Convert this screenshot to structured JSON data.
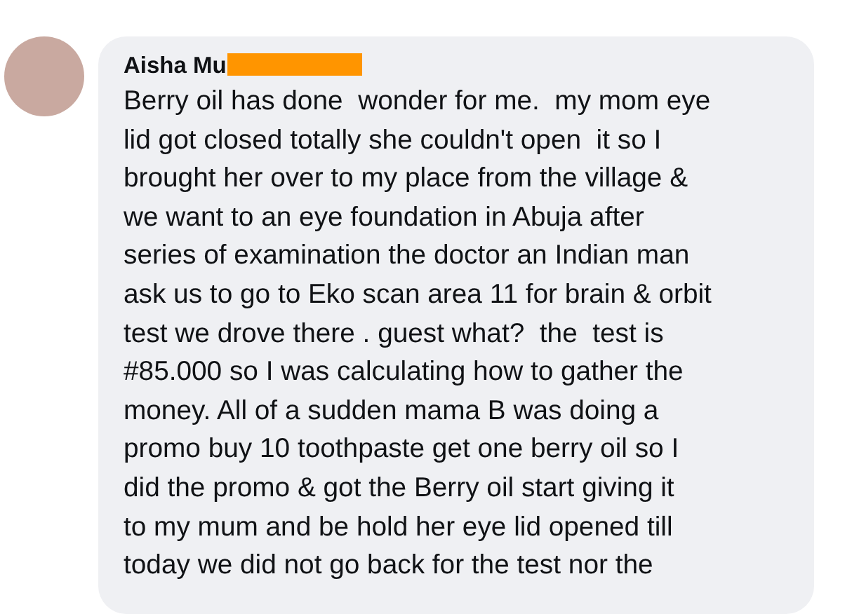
{
  "comment": {
    "author": "Aisha Mu",
    "author_redacted": true,
    "lines": [
      "Berry oil has done  wonder for me.  my mom eye",
      "lid got closed totally she couldn't open  it so I",
      "brought her over to my place from the village &",
      "we want to an eye foundation in Abuja after",
      "series of examination the doctor an Indian man",
      "ask us to go to Eko scan area 11 for brain & orbit",
      "test we drove there . guest what?  the  test is",
      "#85.000 so I was calculating how to gather the",
      "money. All of a sudden mama B was doing a",
      "promo buy 10 toothpaste get one berry oil so I",
      "did the promo & got the Berry oil start giving it",
      "to my mum and be hold her eye lid opened till",
      "today we did not go back for the test nor the"
    ]
  }
}
